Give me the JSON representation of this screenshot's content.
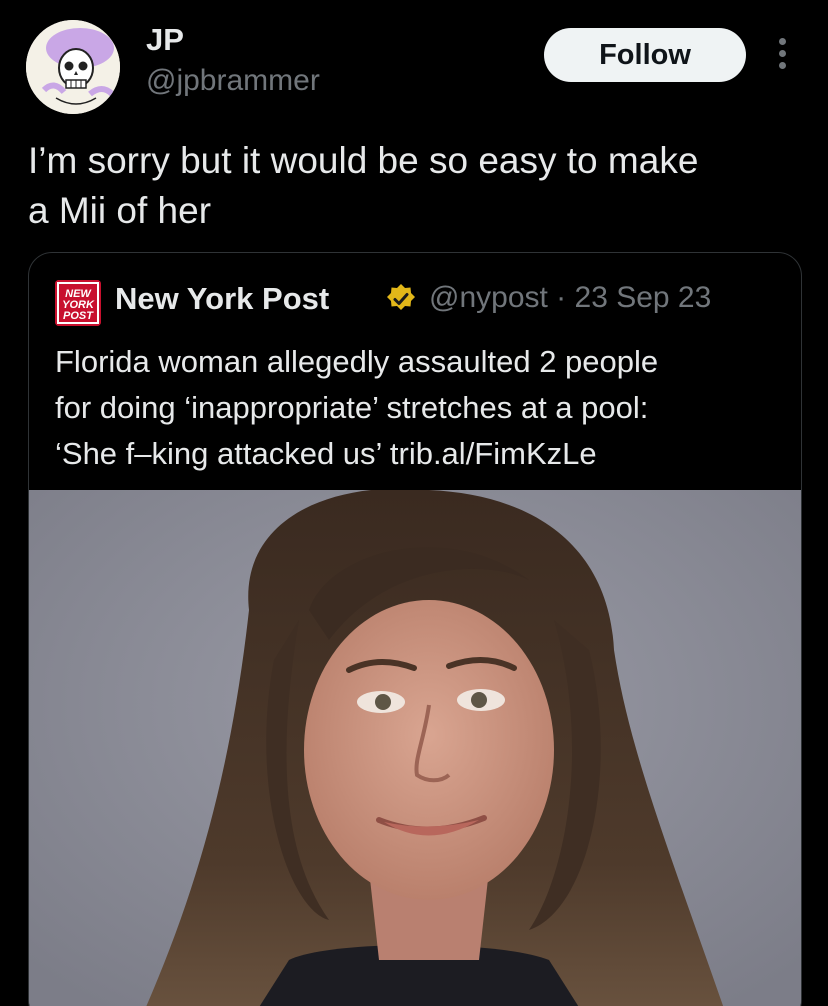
{
  "author": {
    "name": "JP",
    "handle": "@jpbrammer"
  },
  "follow_button": {
    "label": "Follow"
  },
  "tweet": {
    "lines": [
      "I’m sorry but it would be so easy to make",
      "a Mii of her"
    ]
  },
  "quoted": {
    "logo_text": "NEW YORK POST",
    "name": "New York Post",
    "handle_date": "@nypost · 23 Sep 23",
    "lines": [
      "Florida woman allegedly assaulted 2 people",
      "for doing ‘inappropriate’ stretches at a pool:",
      "‘She f–king attacked us’ trib.al/FimKzLe"
    ]
  },
  "colors": {
    "background": "#000000",
    "text": "#e7e9ea",
    "muted": "#71767b",
    "border": "#2f3336",
    "verified": "#e2b719",
    "nyp_red": "#c8102e"
  },
  "icons": {
    "more": "more-vertical-icon",
    "verified": "verified-badge-icon"
  }
}
